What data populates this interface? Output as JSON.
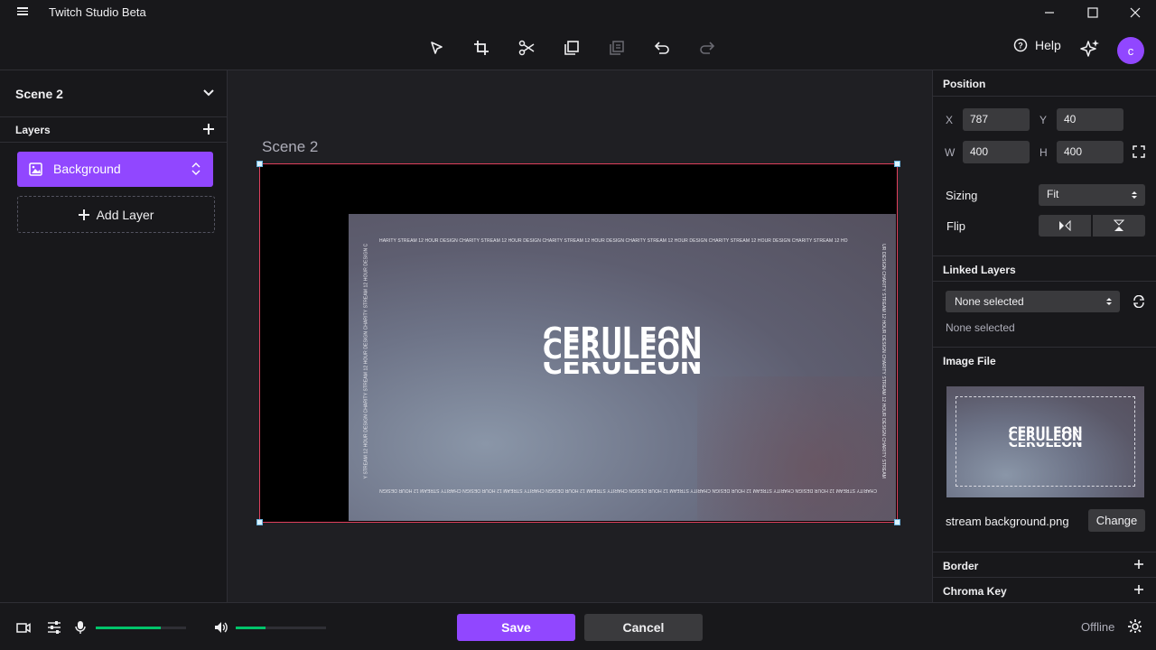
{
  "app": {
    "title": "Twitch Studio Beta"
  },
  "header": {
    "help_label": "Help",
    "avatar_initial": "c"
  },
  "left": {
    "scene_label": "Scene 2",
    "layers_title": "Layers",
    "layers": [
      {
        "name": "Background"
      }
    ],
    "add_layer_label": "Add Layer"
  },
  "canvas": {
    "scene_title": "Scene 2",
    "image": {
      "logo_lines": [
        "CERULEON",
        "CERULEON",
        "CERULEON"
      ],
      "top_text": "HARITY STREAM 12 HOUR DESIGN CHARITY STREAM 12 HOUR DESIGN CHARITY STREAM 12 HOUR DESIGN CHARITY STREAM 12 HOUR DESIGN CHARITY STREAM 12 HOUR DESIGN CHARITY STREAM 12 HO",
      "bottom_text": "CHARITY STREAM 12 HOUR DESIGN CHARITY STREAM 12 HOUR DESIGN CHARITY STREAM 12 HOUR DESIGN CHARITY STREAM 12 HOUR DESIGN CHARITY STREAM 12 HOUR DESIGN CHARITY STREAM 12 HOUR DESIGN",
      "left_text": "Y STREAM 12 HOUR DESIGN CHARITY STREAM 12 HOUR DESIGN CHARITY STREAM 12 HOUR DESIGN C",
      "right_text": "UR DESIGN CHARITY STREAM 12 HOUR DESIGN CHARITY STREAM 12 HOUR DESIGN CHARITY STREAM"
    }
  },
  "right": {
    "position": {
      "title": "Position",
      "x_label": "X",
      "x_value": "787",
      "y_label": "Y",
      "y_value": "40",
      "w_label": "W",
      "w_value": "400",
      "h_label": "H",
      "h_value": "400",
      "sizing_label": "Sizing",
      "sizing_value": "Fit",
      "flip_label": "Flip"
    },
    "linked_layers": {
      "title": "Linked Layers",
      "select_value": "None selected",
      "status": "None selected"
    },
    "image_file": {
      "title": "Image File",
      "filename": "stream background.png",
      "change_label": "Change"
    },
    "border_title": "Border",
    "chroma_title": "Chroma Key"
  },
  "bottom": {
    "mic_level": 0.72,
    "volume_level": 0.33,
    "save_label": "Save",
    "cancel_label": "Cancel",
    "status": "Offline"
  },
  "colors": {
    "accent": "#9147ff",
    "meter": "#00c46b",
    "selection": "#e0405c"
  }
}
